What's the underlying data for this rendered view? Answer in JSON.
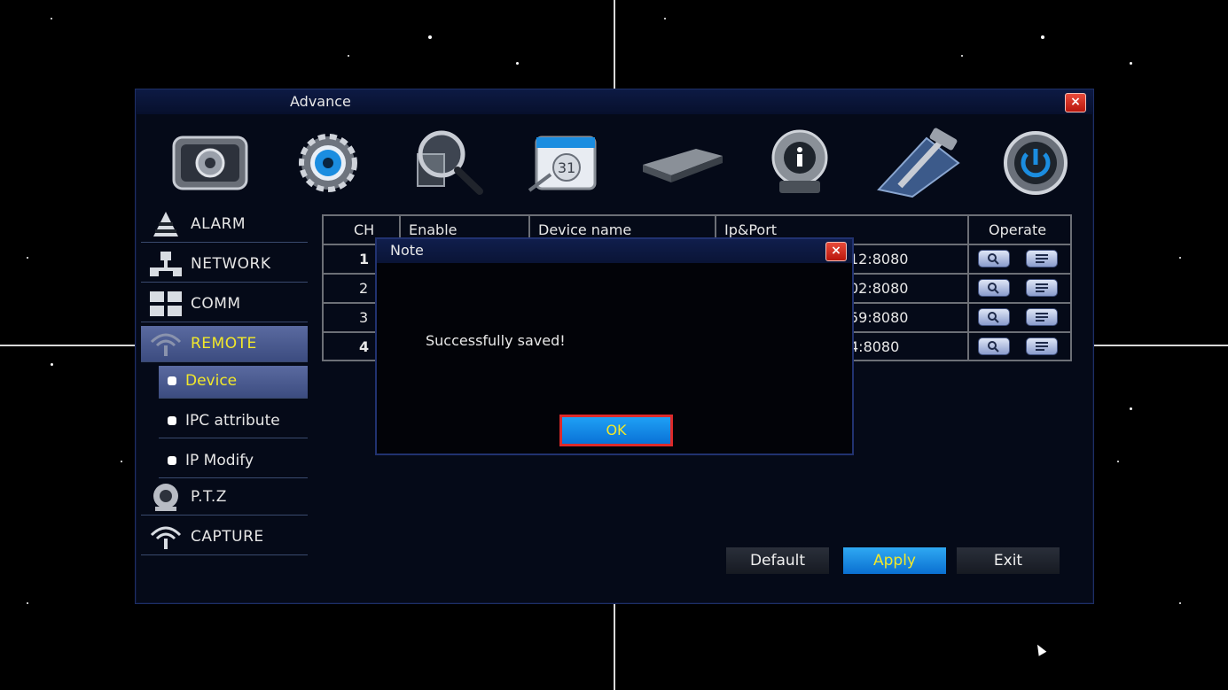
{
  "window": {
    "title": "Advance",
    "close_label": "×"
  },
  "toolbar": {
    "icons": [
      "system-settings-icon",
      "gear-icon",
      "search-magnifier-icon",
      "calendar-icon",
      "hard-disk-icon",
      "info-icon",
      "tools-icon",
      "power-icon"
    ]
  },
  "sidebar": {
    "items": [
      {
        "label": "ALARM",
        "icon": "alarm-cone-icon"
      },
      {
        "label": "NETWORK",
        "icon": "network-icon"
      },
      {
        "label": "COMM",
        "icon": "comm-grid-icon"
      },
      {
        "label": "REMOTE",
        "icon": "wifi-antenna-icon",
        "active": true
      },
      {
        "label": "P.T.Z",
        "icon": "ptz-camera-icon"
      },
      {
        "label": "CAPTURE",
        "icon": "antenna-icon"
      }
    ],
    "sub_items": [
      {
        "label": "Device",
        "active": true
      },
      {
        "label": "IPC attribute"
      },
      {
        "label": "IP Modify"
      }
    ]
  },
  "table": {
    "headers": [
      "CH",
      "Enable",
      "Device name",
      "Ip&Port",
      "Operate"
    ],
    "rows": [
      {
        "ch": "1",
        "ip_port": "12:8080"
      },
      {
        "ch": "2",
        "ip_port": "02:8080"
      },
      {
        "ch": "3",
        "ip_port": "59:8080"
      },
      {
        "ch": "4",
        "ip_port": "4:8080"
      }
    ]
  },
  "buttons": {
    "default": "Default",
    "apply": "Apply",
    "exit": "Exit"
  },
  "dialog": {
    "title": "Note",
    "message": "Successfully saved!",
    "ok": "OK",
    "close_label": "×"
  }
}
